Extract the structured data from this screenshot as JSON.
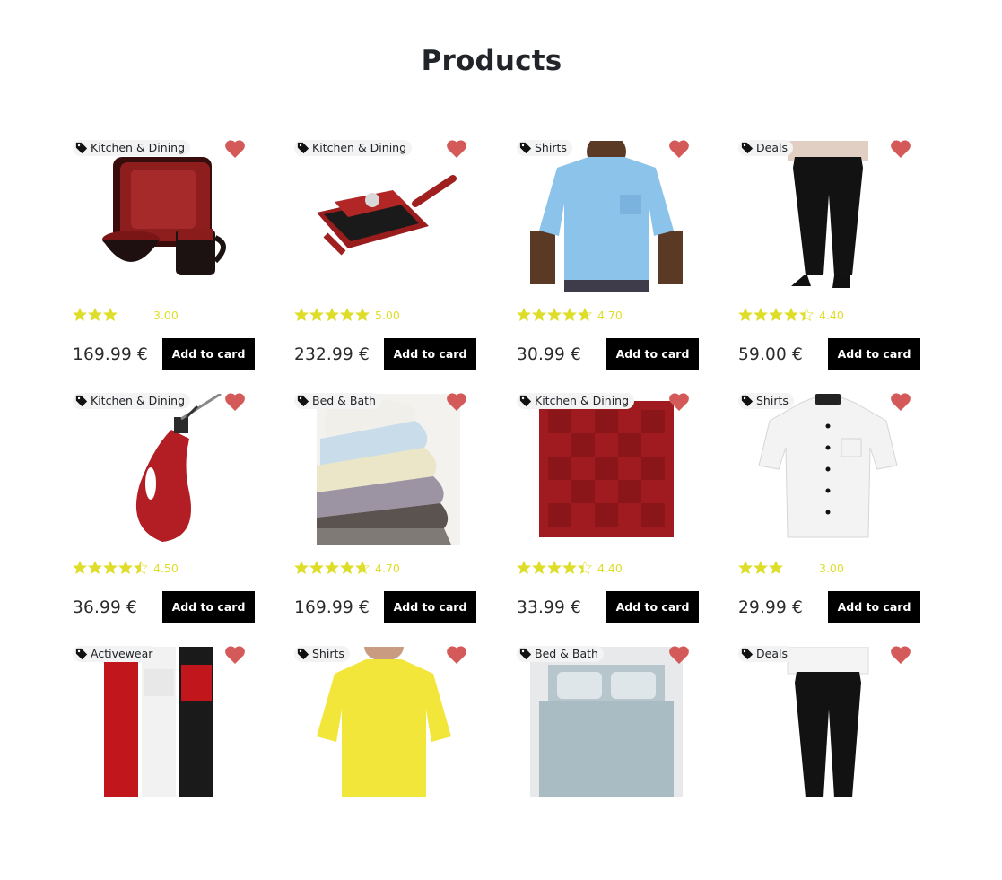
{
  "page": {
    "title": "Products"
  },
  "colors": {
    "heart": "#d45a5a",
    "star": "#dede2a",
    "button_bg": "#000000",
    "button_text": "#ffffff"
  },
  "products": [
    {
      "category": "Kitchen & Dining",
      "rating": 3.0,
      "rating_label": "3.00",
      "price": "169.99 €",
      "button": "Add to card",
      "image": "red-dinnerware-set"
    },
    {
      "category": "Kitchen & Dining",
      "rating": 5.0,
      "rating_label": "5.00",
      "price": "232.99 €",
      "button": "Add to card",
      "image": "red-grill-pan"
    },
    {
      "category": "Shirts",
      "rating": 4.7,
      "rating_label": "4.70",
      "price": "30.99 €",
      "button": "Add to card",
      "image": "blue-tshirt"
    },
    {
      "category": "Deals",
      "rating": 4.4,
      "rating_label": "4.40",
      "price": "59.00 €",
      "button": "Add to card",
      "image": "black-pants"
    },
    {
      "category": "Kitchen & Dining",
      "rating": 4.5,
      "rating_label": "4.50",
      "price": "36.99 €",
      "button": "Add to card",
      "image": "red-oil-cruet"
    },
    {
      "category": "Bed & Bath",
      "rating": 4.7,
      "rating_label": "4.70",
      "price": "169.99 €",
      "button": "Add to card",
      "image": "folded-sheets"
    },
    {
      "category": "Kitchen & Dining",
      "rating": 4.4,
      "rating_label": "4.40",
      "price": "33.99 €",
      "button": "Add to card",
      "image": "red-tablecloth"
    },
    {
      "category": "Shirts",
      "rating": 3.0,
      "rating_label": "3.00",
      "price": "29.99 €",
      "button": "Add to card",
      "image": "white-chef-shirt"
    },
    {
      "category": "Activewear",
      "image": "athletic-socks"
    },
    {
      "category": "Shirts",
      "image": "yellow-tshirt"
    },
    {
      "category": "Bed & Bath",
      "image": "bedding-set"
    },
    {
      "category": "Deals",
      "image": "black-pants-2"
    }
  ]
}
